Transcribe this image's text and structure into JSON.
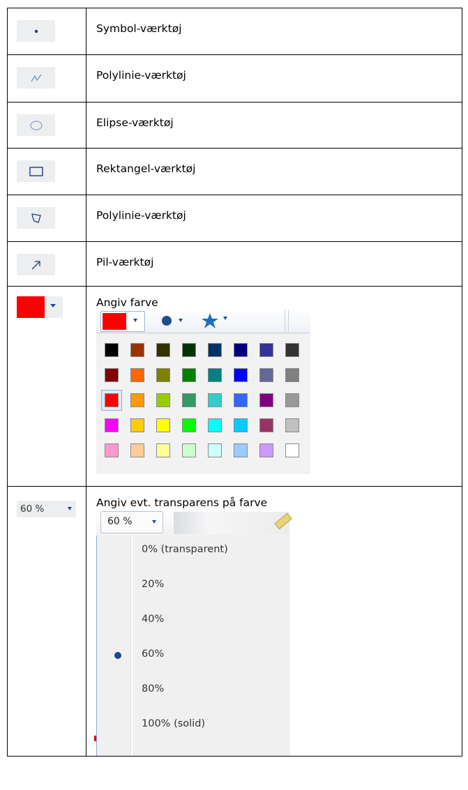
{
  "rows": [
    {
      "icon": "dot-symbol-icon",
      "label": "Symbol-værktøj"
    },
    {
      "icon": "polyline-icon",
      "label": "Polylinie-værktøj"
    },
    {
      "icon": "ellipse-icon",
      "label": "Elipse-værktøj"
    },
    {
      "icon": "rectangle-icon",
      "label": "Rektangel-værktøj"
    },
    {
      "icon": "polygon-icon",
      "label": "Polylinie-værktøj"
    },
    {
      "icon": "arrow-icon",
      "label": "Pil-værktøj"
    }
  ],
  "color_row": {
    "label": "Angiv farve",
    "selected_color": "#ff0000",
    "palette": [
      [
        "#000000",
        "#993300",
        "#333300",
        "#003300",
        "#003366",
        "#000080",
        "#333399",
        "#333333"
      ],
      [
        "#800000",
        "#ff6600",
        "#808000",
        "#008000",
        "#008080",
        "#0000ff",
        "#666699",
        "#808080"
      ],
      [
        "#ff0000",
        "#ff9900",
        "#99cc00",
        "#339966",
        "#33cccc",
        "#3366ff",
        "#800080",
        "#999999"
      ],
      [
        "#ff00ff",
        "#ffcc00",
        "#ffff00",
        "#00ff00",
        "#00ffff",
        "#00ccff",
        "#993366",
        "#c0c0c0"
      ],
      [
        "#ff99cc",
        "#ffcc99",
        "#ffff99",
        "#ccffcc",
        "#ccffff",
        "#99ccff",
        "#cc99ff",
        "#ffffff"
      ]
    ]
  },
  "transparency_row": {
    "button_value": "60 %",
    "label": "Angiv evt. transparens på farve",
    "dropdown_value": "60 %",
    "options": [
      "0% (transparent)",
      "20%",
      "40%",
      "60%",
      "80%",
      "100% (solid)"
    ],
    "selected_index": 3
  }
}
